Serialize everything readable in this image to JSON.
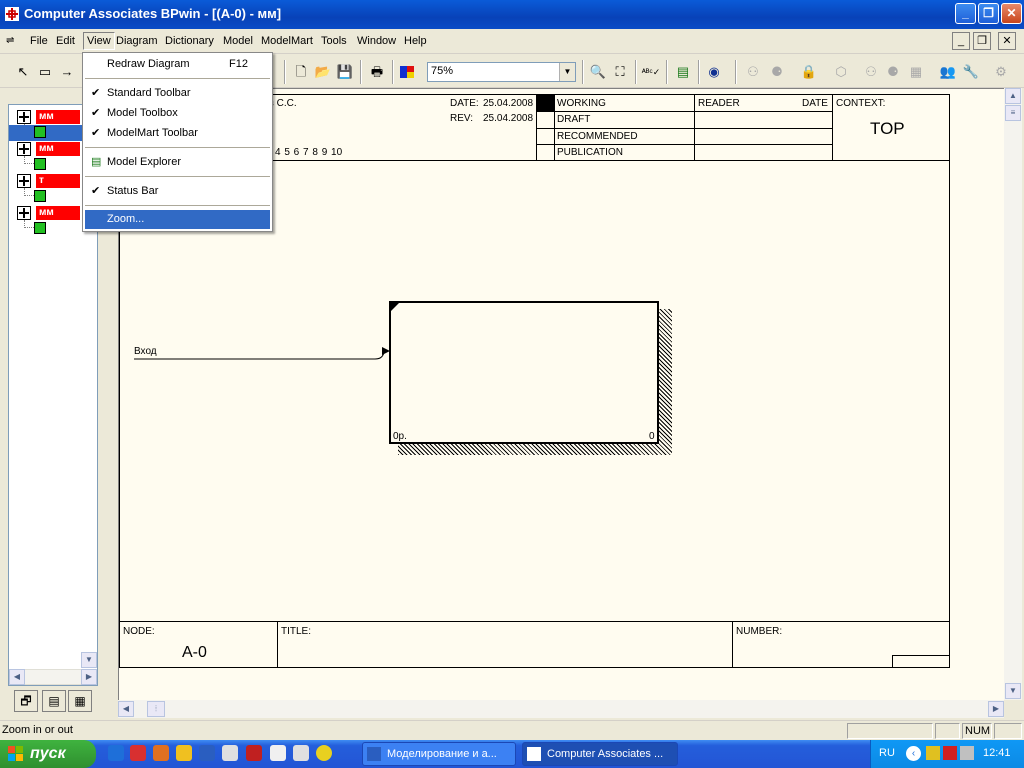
{
  "window": {
    "title": "Computer Associates BPwin - [(A-0)  - мм]"
  },
  "menubar": {
    "items": [
      "File",
      "Edit",
      "View",
      "Diagram",
      "Dictionary",
      "Model",
      "ModelMart",
      "Tools",
      "Window",
      "Help"
    ]
  },
  "toolbar": {
    "zoom_value": "75%"
  },
  "view_menu": {
    "items": [
      {
        "label": "Redraw Diagram",
        "accel": "F12",
        "checked": false
      },
      {
        "label": "Standard Toolbar",
        "checked": true
      },
      {
        "label": "Model Toolbox",
        "checked": true
      },
      {
        "label": "ModelMart Toolbar",
        "checked": true
      },
      {
        "label": "Model Explorer",
        "checked": false
      },
      {
        "label": "Status Bar",
        "checked": true
      },
      {
        "label": "Zoom...",
        "checked": false,
        "highlighted": true
      }
    ]
  },
  "explorer": {
    "items": [
      {
        "label": "мм",
        "color": "#ff0000"
      },
      {
        "label": "мм",
        "color": "#ff0000"
      },
      {
        "label": "т",
        "color": "#ff0000"
      },
      {
        "label": "мм",
        "color": "#ff0000"
      }
    ]
  },
  "diagram": {
    "header": {
      "author_fragment": "ов С.С.",
      "date_label": "DATE:",
      "date_value": "25.04.2008",
      "rev_label": "REV:",
      "rev_value": "25.04.2008",
      "numbers": "4  5  6  7  8  9  10",
      "status": [
        "WORKING",
        "DRAFT",
        "RECOMMENDED",
        "PUBLICATION"
      ],
      "reader_label": "READER",
      "reader_date_label": "DATE",
      "context_label": "CONTEXT:",
      "context_value": "TOP"
    },
    "activity": {
      "cost": "0р.",
      "number": "0"
    },
    "arrow_label": "Вход",
    "footer": {
      "node_label": "NODE:",
      "node_value": "A-0",
      "title_label": "TITLE:",
      "number_label": "NUMBER:"
    }
  },
  "statusbar": {
    "message": "Zoom in or out",
    "num": "NUM"
  },
  "taskbar": {
    "start_label": "пуск",
    "tasks": [
      "Моделирование и а...",
      "Computer Associates ..."
    ],
    "lang": "RU",
    "clock": "12:41"
  }
}
